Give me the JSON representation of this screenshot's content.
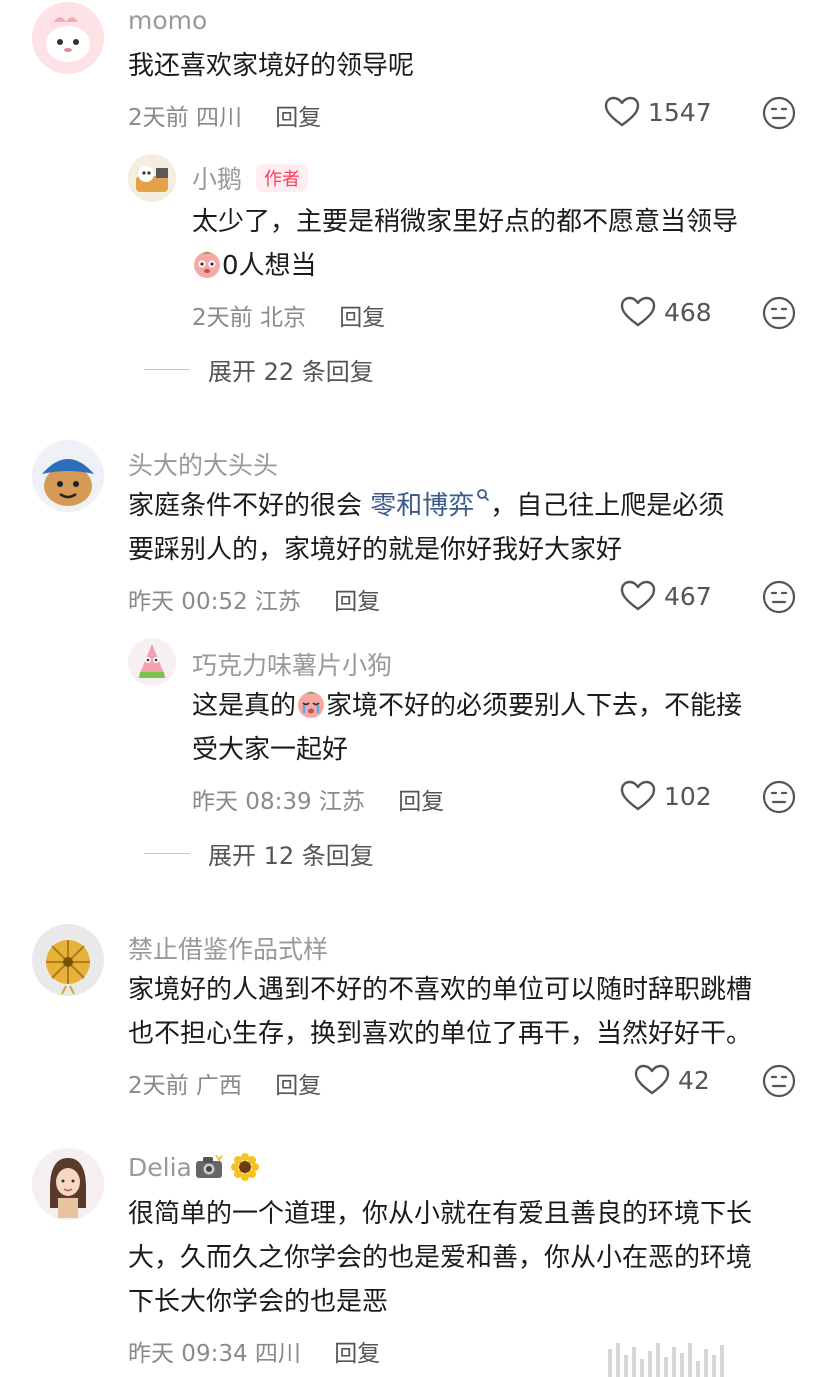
{
  "comments": [
    {
      "user": "momo",
      "text": [
        "我还喜欢家境好的领导呢"
      ],
      "time": "2天前",
      "location": "四川",
      "reply_label": "回复",
      "likes": "1547",
      "replies": [
        {
          "user": "小鹅",
          "badge": "作者",
          "text_line1": "太少了，主要是稍微家里好点的都不愿意当领导",
          "text_line2": "0人想当",
          "time": "2天前",
          "location": "北京",
          "reply_label": "回复",
          "likes": "468"
        }
      ],
      "expand": "展开 22 条回复"
    },
    {
      "user": "头大的大头头",
      "text_before_link": "家庭条件不好的很会 ",
      "link": "零和博弈",
      "text_after_link": "，自己往上爬是必须",
      "text_line2": "要踩别人的，家境好的就是你好我好大家好",
      "time": "昨天 00:52",
      "location": "江苏",
      "reply_label": "回复",
      "likes": "467",
      "replies": [
        {
          "user": "巧克力味薯片小狗",
          "text_line1a": "这是真的",
          "text_line1b": "家境不好的必须要别人下去，不能接",
          "text_line2": "受大家一起好",
          "time": "昨天 08:39",
          "location": "江苏",
          "reply_label": "回复",
          "likes": "102"
        }
      ],
      "expand": "展开 12 条回复"
    },
    {
      "user": "禁止借鉴作品式样",
      "text": [
        "家境好的人遇到不好的不喜欢的单位可以随时辞职跳槽",
        "也不担心生存，换到喜欢的单位了再干，当然好好干。"
      ],
      "time": "2天前",
      "location": "广西",
      "reply_label": "回复",
      "likes": "42"
    },
    {
      "user": "Delia",
      "text": [
        "很简单的一个道理，你从小就在有爱且善良的环境下长",
        "大，久而久之你学会的也是爱和善，你从小在恶的环境",
        "下长大你学会的也是恶"
      ],
      "time": "昨天 09:34",
      "location": "四川",
      "reply_label": "回复"
    }
  ],
  "icons": {
    "like": "heart-outline-icon",
    "dislike": "neutral-face-icon",
    "search": "search-icon"
  }
}
